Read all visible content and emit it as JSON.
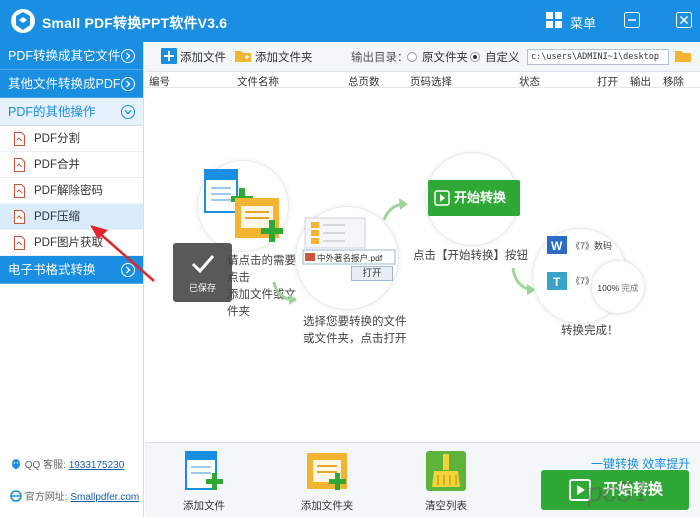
{
  "app": {
    "title": "Small PDF转换PPT软件V3.6",
    "menu_label": "菜单"
  },
  "sidebar": {
    "categories": [
      {
        "label": "PDF转换成其它文件"
      },
      {
        "label": "其他文件转换成PDF"
      },
      {
        "label": "PDF的其他操作"
      },
      {
        "label": "电子书格式转换"
      }
    ],
    "items": [
      {
        "label": "PDF分割"
      },
      {
        "label": "PDF合并"
      },
      {
        "label": "PDF解除密码"
      },
      {
        "label": "PDF压缩"
      },
      {
        "label": "PDF图片获取"
      }
    ],
    "qq_label": "QQ 客服:",
    "qq_number": "1933175230",
    "site_label": "官方网址:",
    "site_url": "Smallpdfer.com"
  },
  "toolbar": {
    "add_file": "添加文件",
    "add_folder": "添加文件夹",
    "output_label": "输出目录：",
    "option_original": "原文件夹",
    "option_custom": "自定义",
    "output_path": "c:\\users\\ADMINI~1\\desktop"
  },
  "table": {
    "headers": [
      "编号",
      "文件名称",
      "总页数",
      "页码选择",
      "状态",
      "打开",
      "输出",
      "移除"
    ]
  },
  "guide": {
    "step1_text": [
      "请点击的需要点击",
      "添加文件或文件夹"
    ],
    "step2_file": "中外著名报户.pdf",
    "step2_open": "打开",
    "step2_text": [
      "选择您要转换的文件",
      "或文件夹，点击打开"
    ],
    "step3_button": "开始转换",
    "step3_text": "点击【开始转换】按钮",
    "step4_item1": "《7》数码",
    "step4_item2": "《7》",
    "step4_percent": "100%",
    "step4_done": "完成",
    "step4_text": "转换完成！"
  },
  "toast": {
    "label": "已保存"
  },
  "bottom": {
    "add_file": "添加文件",
    "add_folder": "添加文件夹",
    "clear_list": "清空列表",
    "slogan": "一键转换  效率提升",
    "start": "开始转换"
  },
  "watermark": "pc51",
  "colors": {
    "brand_blue": "#1a8ee1",
    "start_green": "#2fa836",
    "annotation_red": "#e0262a"
  }
}
